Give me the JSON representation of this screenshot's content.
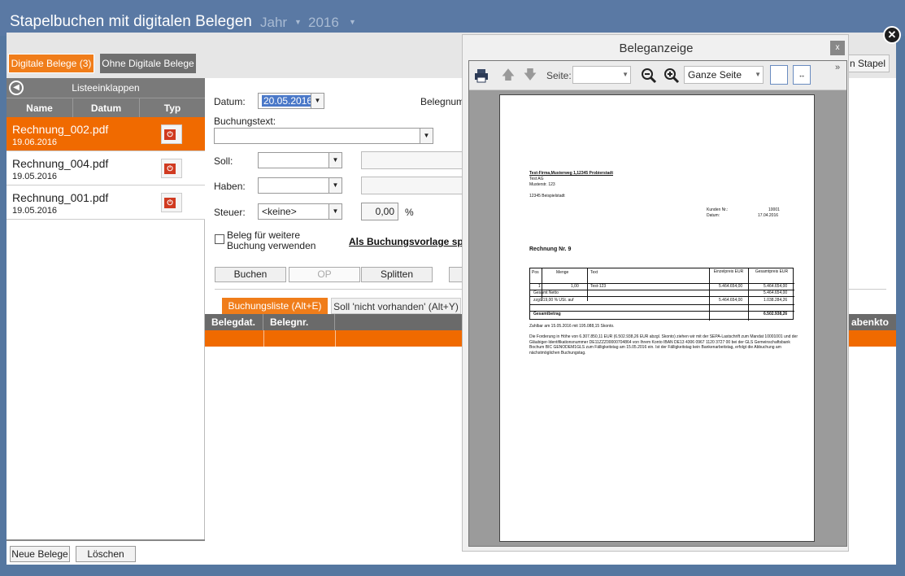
{
  "app": {
    "title": "Stapelbuchen mit digitalen Belegen",
    "year_label": "Jahr",
    "year_value": "2016",
    "close_glyph": "✕"
  },
  "tabs": {
    "digital": "Digitale Belege (3)",
    "non_digital": "Ohne Digitale Belege"
  },
  "left": {
    "collapse_label": "Listeeinklappen",
    "columns": [
      "Name",
      "Datum",
      "Typ"
    ],
    "files": [
      {
        "name": "Rechnung_002.pdf",
        "date": "19.06.2016"
      },
      {
        "name": "Rechnung_004.pdf",
        "date": "19.05.2016"
      },
      {
        "name": "Rechnung_001.pdf",
        "date": "19.05.2016"
      }
    ],
    "new_button": "Neue Belege",
    "delete_button": "Löschen"
  },
  "form": {
    "datum_label": "Datum:",
    "datum_value": "20.05.2016",
    "belegnummer_label": "Belegnumr",
    "buchungstext_label": "Buchungstext:",
    "soll_label": "Soll:",
    "haben_label": "Haben:",
    "steuer_label": "Steuer:",
    "steuer_value": "<keine>",
    "percent_value": "0,00",
    "percent_sign": "%",
    "checkbox_label_1": "Beleg für weitere",
    "checkbox_label_2": "Buchung verwenden",
    "vorlage_link": "Als Buchungsvorlage spe",
    "buchen": "Buchen",
    "op": "OP",
    "splitten": "Splitten",
    "list_tab_active": "Buchungsliste (Alt+E)",
    "list_tab": "Soll 'nicht vorhanden' (Alt+Y)",
    "grid_cols": [
      "Belegdat.",
      "Belegnr."
    ],
    "grid_col_right": "abenkto",
    "stapel_button": "n Stapel"
  },
  "viewer": {
    "title": "Beleganzeige",
    "close": "x",
    "page_label": "Seite:",
    "zoom_mode": "Ganze Seite",
    "more": "»"
  },
  "document": {
    "sender_line": "Test-Firma,Musterweg 1,12345 Probierstadt",
    "recipient": [
      "Test AG",
      "Musterstr. 123",
      "",
      "12345 Beispielstadt"
    ],
    "kunden_label": "Kunden Nr.:",
    "kunden_value": "10001",
    "datum_label": "Datum:",
    "datum_value": "17.04.2016",
    "invoice_title": "Rechnung Nr. 9",
    "table_headers": [
      "Pos",
      "Menge",
      "Text",
      "Einzelpreis EUR",
      "Gesamtpreis EUR"
    ],
    "row": {
      "pos": "1",
      "menge": "1,00",
      "text": "Test-123",
      "einzel": "5.464.654,00",
      "gesamt": "5.464.654,00"
    },
    "netto_label": "Gesamt Netto",
    "netto_value": "5.464.654,00",
    "ust_label": "zzgl. 19,00 % USt. auf",
    "ust_base": "5.464.654,00",
    "ust_value": "1.038.284,26",
    "total_label": "Gesamtbetrag",
    "total_value": "6.502.938,26",
    "payment_line": "Zahlbar am 15.05.2016 mit 195.088,15  Skonto.",
    "sepa_text": "Die Forderung in Höhe von 6.307.850,11 EUR (6.502.938,26 EUR abzgl. Skonto) ziehen wir mit der SEPA-Lastschrift zum Mandat 10001001 und der Gläubiger-Identifikationsnummer DE11ZZZ00000704864 von Ihrem Konto IBAN DE13 4306 0967 1120 3727 00 bei der GLS Gemeinschaftsbank Bochum BIC GENODEM1GLS zum Fälligkeitstag am 15.05.2016 ein. Ist der Fälligkeitstag kein Bankenarbeitstag, erfolgt die Abbuchung am nächstmöglichen Buchungstag."
  },
  "colors": {
    "accent": "#f06a00",
    "header": "#5a79a4",
    "grey_header": "#7a7a7a"
  }
}
